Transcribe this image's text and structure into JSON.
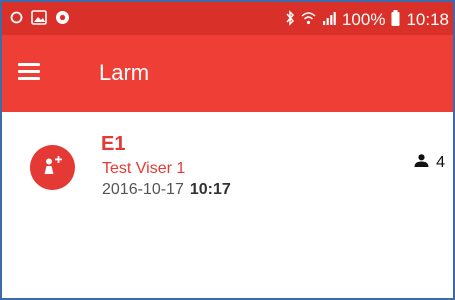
{
  "colors": {
    "status_bar": "#d93029",
    "app_bar": "#ef3e36",
    "accent": "#e53935",
    "frame_border": "#3d6aa8"
  },
  "status_bar": {
    "left_icons": [
      "ring-icon",
      "gallery-icon",
      "chrome-icon"
    ],
    "right_icons": [
      "bluetooth-icon",
      "wifi-icon",
      "signal-icon",
      "battery-icon"
    ],
    "battery": "100%",
    "time": "10:18"
  },
  "app_bar": {
    "menu_icon": "menu-icon",
    "title": "Larm"
  },
  "alarm": {
    "avatar_icon": "person-add-icon",
    "title": "E1",
    "subtitle": "Test Viser 1",
    "date": "2016-10-17",
    "time": "10:17",
    "user_icon": "person-icon",
    "user_count": "4"
  }
}
